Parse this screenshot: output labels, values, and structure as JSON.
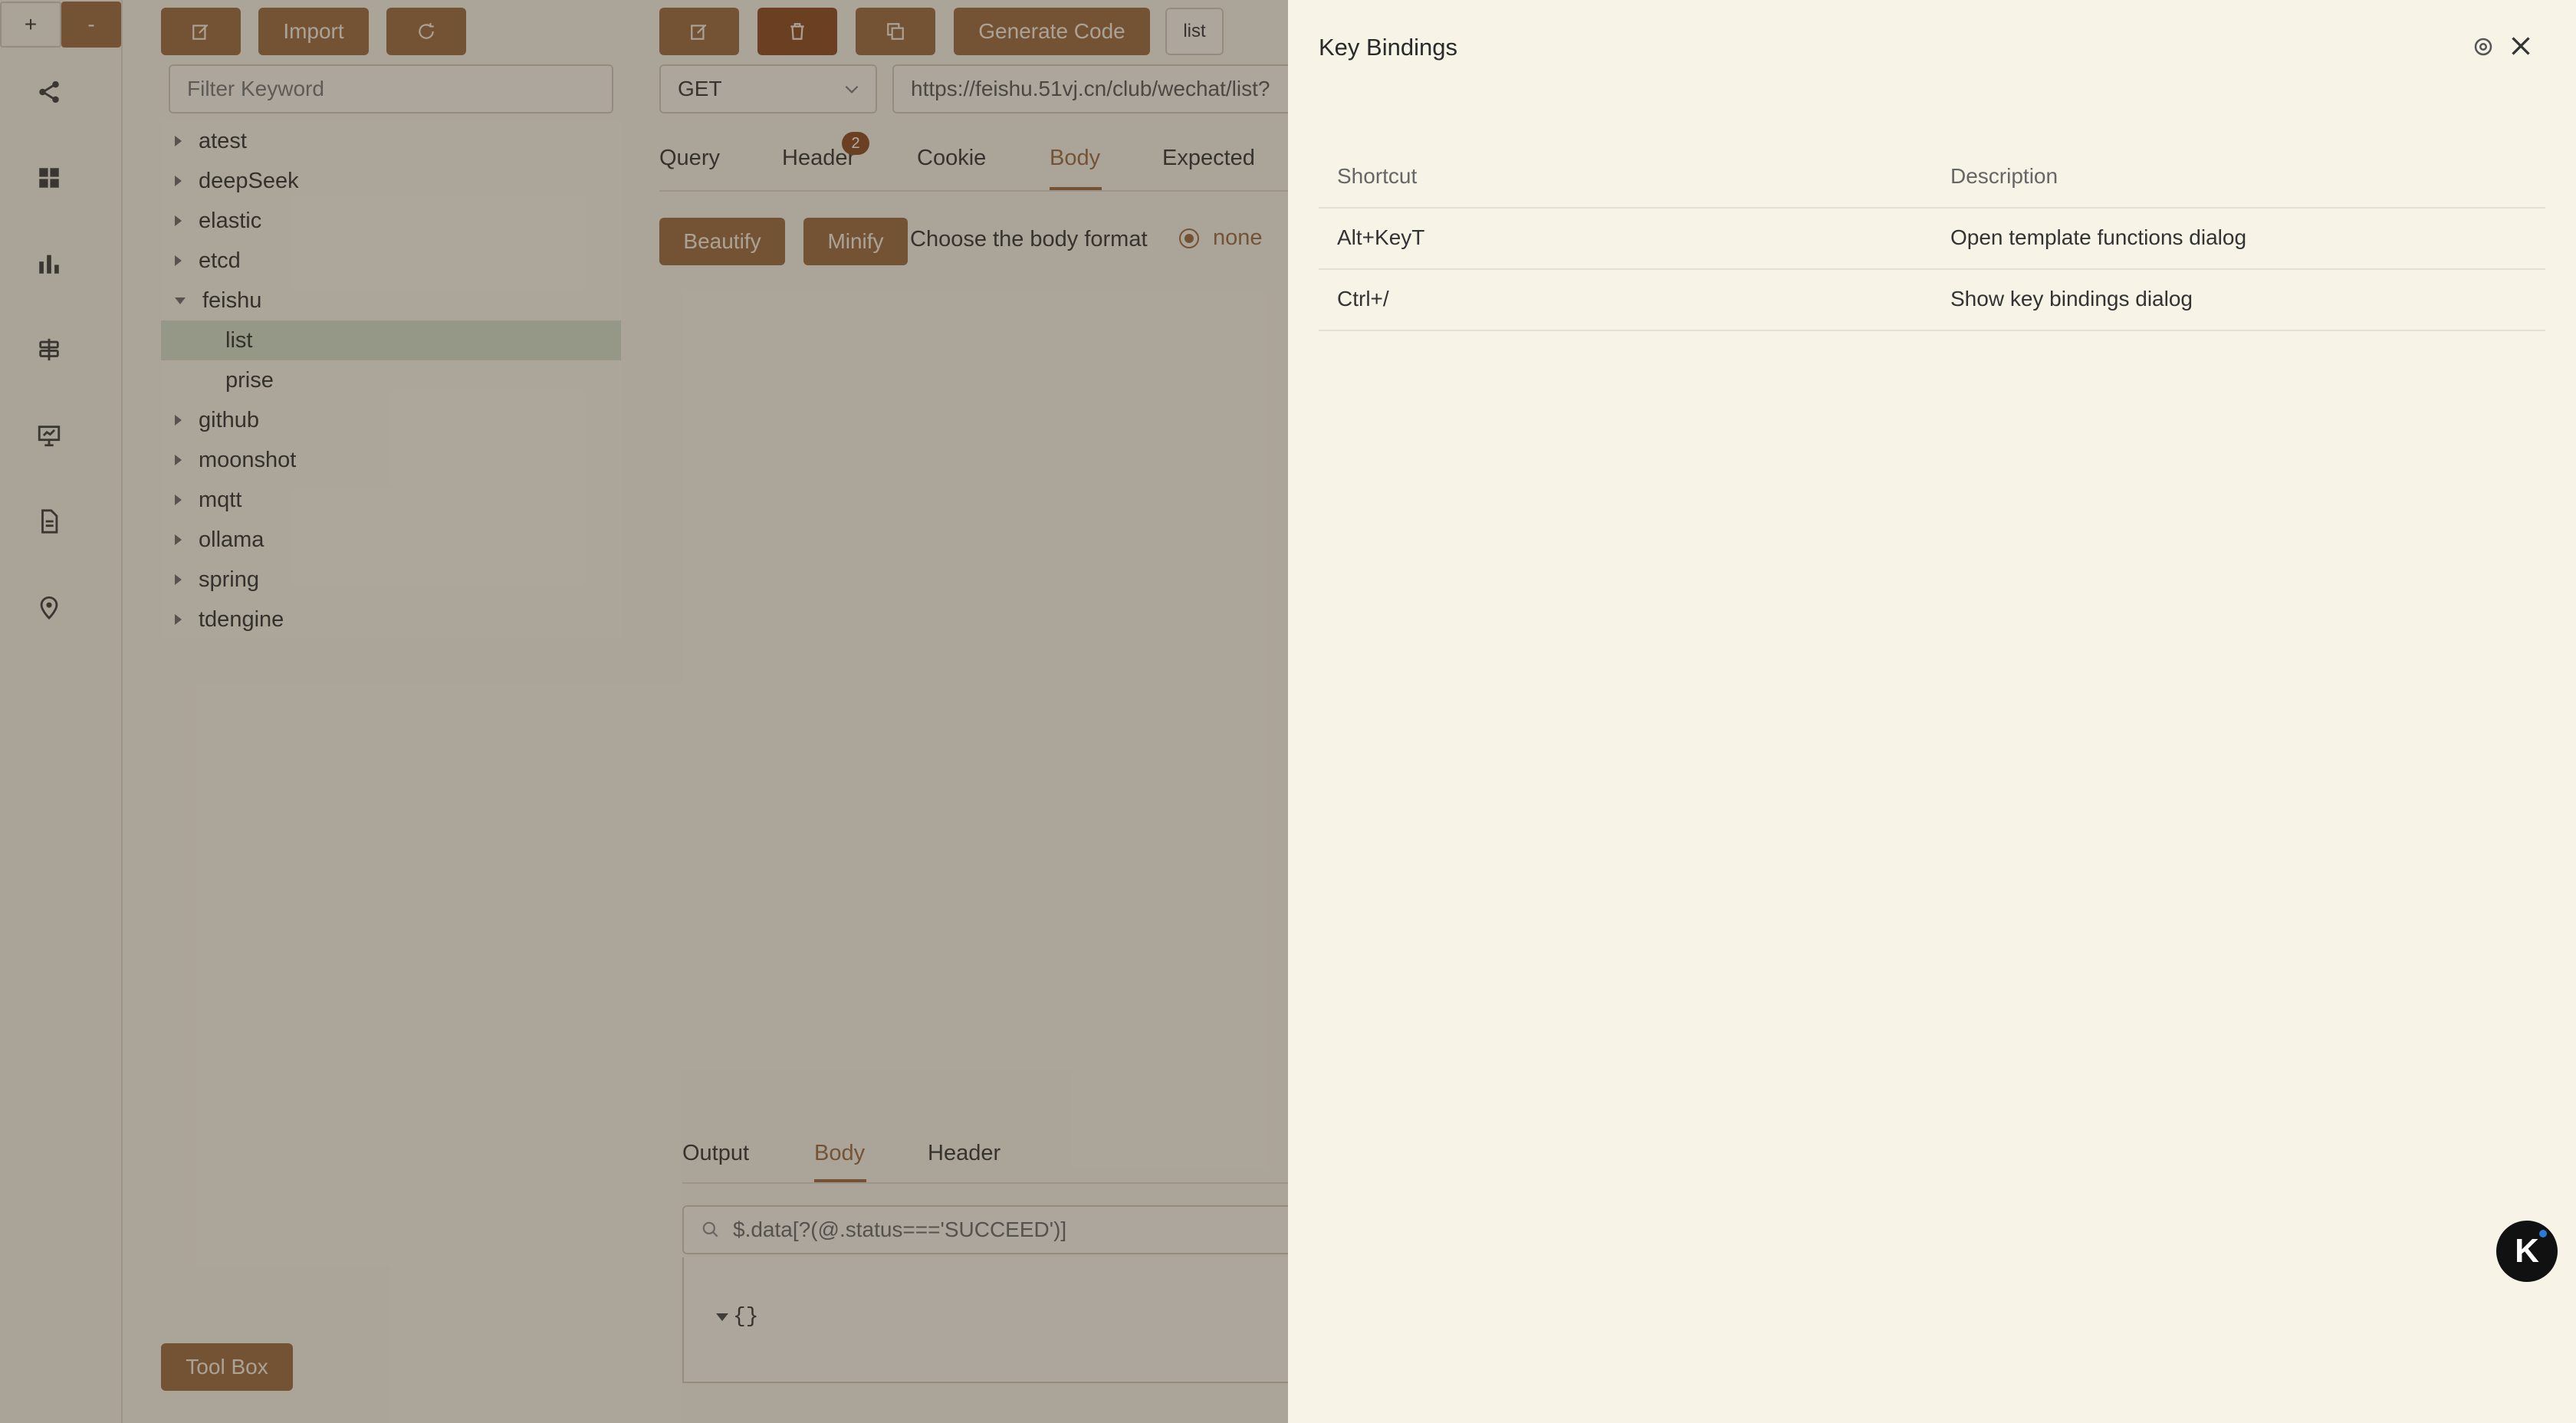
{
  "sidebar": {
    "zoom_in": "+",
    "zoom_out": "-",
    "icons": [
      "share-icon",
      "grid-icon",
      "bar-chart-icon",
      "signpost-icon",
      "presentation-icon",
      "document-icon",
      "location-pin-icon"
    ]
  },
  "collection_toolbar": {
    "import_label": "Import",
    "filter_placeholder": "Filter Keyword"
  },
  "tree": {
    "items": [
      {
        "label": "atest",
        "expanded": false
      },
      {
        "label": "deepSeek",
        "expanded": false
      },
      {
        "label": "elastic",
        "expanded": false
      },
      {
        "label": "etcd",
        "expanded": false
      },
      {
        "label": "feishu",
        "expanded": true
      },
      {
        "label": "list",
        "child": true,
        "selected": true
      },
      {
        "label": "prise",
        "child": true
      },
      {
        "label": "github",
        "expanded": false
      },
      {
        "label": "moonshot",
        "expanded": false
      },
      {
        "label": "mqtt",
        "expanded": false
      },
      {
        "label": "ollama",
        "expanded": false
      },
      {
        "label": "spring",
        "expanded": false
      },
      {
        "label": "tdengine",
        "expanded": false
      }
    ]
  },
  "request": {
    "generate_code": "Generate Code",
    "name_tag": "list",
    "method": "GET",
    "url": "https://feishu.51vj.cn/club/wechat/list?",
    "tabs": [
      "Query",
      "Header",
      "Cookie",
      "Body",
      "Expected"
    ],
    "header_count": "2",
    "active_tab": "Body",
    "beautify": "Beautify",
    "minify": "Minify",
    "body_format_label": "Choose the body format",
    "body_format_option": "none"
  },
  "response": {
    "tabs": [
      "Output",
      "Body",
      "Header"
    ],
    "active_tab": "Body",
    "filter_value": "$.data[?(@.status==='SUCCEED')]",
    "json_preview": "{}"
  },
  "toolbox_label": "Tool Box",
  "dialog": {
    "title": "Key Bindings",
    "columns": {
      "shortcut": "Shortcut",
      "description": "Description"
    },
    "rows": [
      {
        "shortcut": "Alt+KeyT",
        "description": "Open template functions dialog"
      },
      {
        "shortcut": "Ctrl+/",
        "description": "Show key bindings dialog"
      }
    ]
  },
  "colors": {
    "accent": "#9a6a3e",
    "accent_dark": "#8a4a1f",
    "panel_bg": "#f7f3e7"
  }
}
